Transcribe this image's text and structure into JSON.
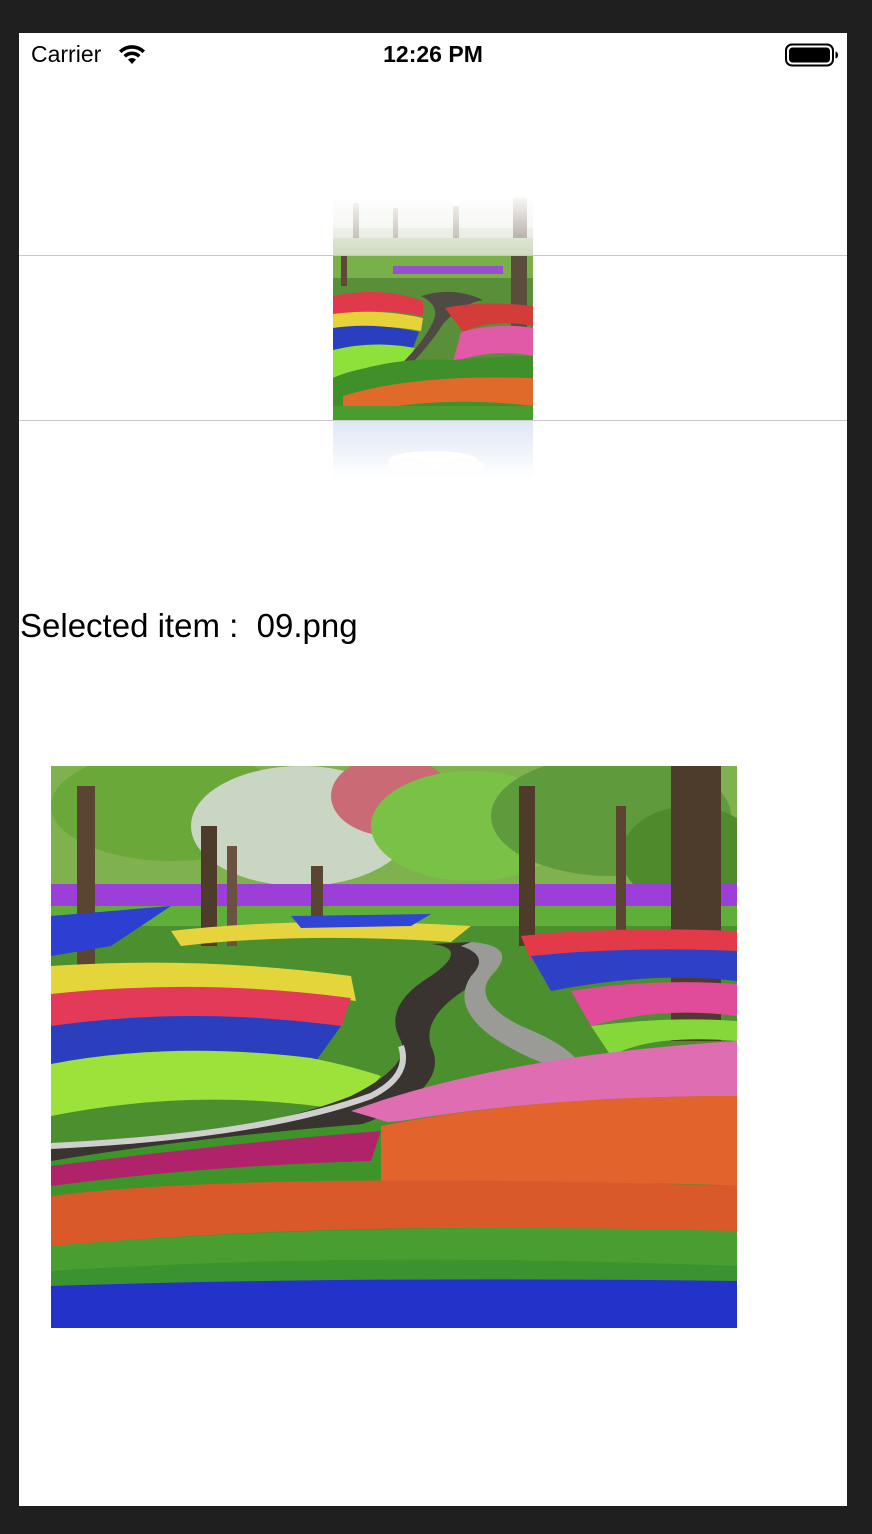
{
  "status_bar": {
    "carrier": "Carrier",
    "time": "12:26 PM",
    "icons": [
      "wifi-icon",
      "battery-icon"
    ]
  },
  "picker": {
    "items": [
      "previous-item-image",
      "selected-item-image",
      "next-item-image"
    ],
    "image_subject": "flower-garden-with-stream"
  },
  "selection": {
    "label": "Selected item :  09.png"
  },
  "colors": {
    "screen_background": "#ffffff",
    "device_frame": "#1f1f1f",
    "separator": "#c8c8cc",
    "text": "#000000"
  }
}
